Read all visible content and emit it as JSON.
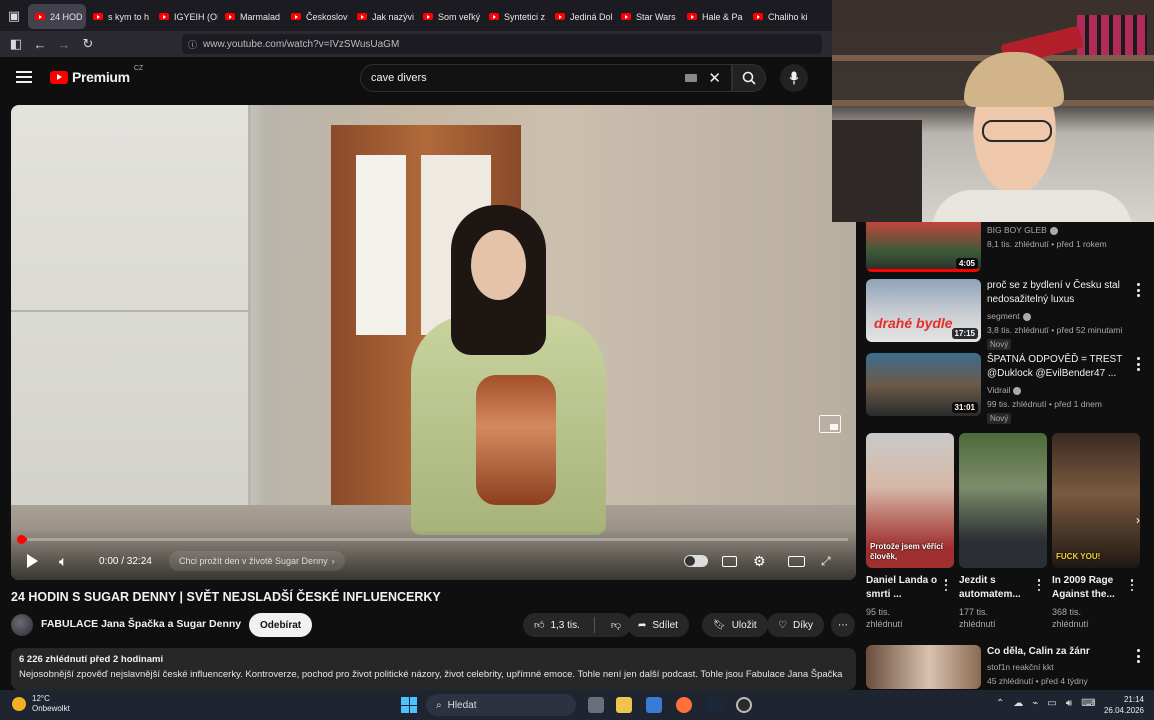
{
  "browser": {
    "tabs": [
      {
        "label": "24 HOD",
        "active": true
      },
      {
        "label": "s kym to h"
      },
      {
        "label": "IGYEIH (OI"
      },
      {
        "label": "Marmalad"
      },
      {
        "label": "Českoslov"
      },
      {
        "label": "Jak nazývi"
      },
      {
        "label": "Som veľký"
      },
      {
        "label": "Syntetici z"
      },
      {
        "label": "Jediná Dol"
      },
      {
        "label": "Star Wars"
      },
      {
        "label": "Hale & Pa"
      },
      {
        "label": "Chaliho ki"
      }
    ],
    "url": "www.youtube.com/watch?v=IVzSWusUaGM"
  },
  "header": {
    "logo_word": "Premium",
    "logo_country": "CZ",
    "search_value": "cave divers"
  },
  "player": {
    "time": "0:00 / 32:24",
    "chapter": "Chci prožít den v životě Sugar Denny",
    "progress_fraction": 0.01
  },
  "video": {
    "title": "24 HODIN S SUGAR DENNY | SVĚT NEJSLADŠÍ ČESKÉ INFLUENCERKY",
    "channel": "FABULACE Jana Špačka a Sugar Denny",
    "subscribe_label": "Odebírat",
    "likes": "1,3 tis.",
    "share_label": "Sdílet",
    "save_label": "Uložit",
    "thanks_label": "Díky",
    "views_date": "6 226 zhlédnutí  před 2 hodinami",
    "description": "Nejosobnější zpověď nejslavnější české influencerky. Kontroverze, pochod pro život politické názory, život celebrity, upřímné emoce. Tohle není jen další podcast. Tohle jsou Fabulace Jana Špačka"
  },
  "recommendations": [
    {
      "title": "",
      "channel": "BIG BOY GLEB",
      "meta": "8,1 tis. zhlédnutí • před 1 rokem",
      "duration": "4:05"
    },
    {
      "title": "proč se z bydlení v Česku stal nedosažitelný luxus",
      "channel": "segment",
      "meta": "3,8 tis. zhlédnutí • před 52 minutami",
      "duration": "17:15",
      "badge": "Nový",
      "thumb_text": "drahé bydle"
    },
    {
      "title": "ŠPATNÁ ODPOVĚĎ = TREST @Duklock @EvilBender47 ...",
      "channel": "Vidrail",
      "meta": "99 tis. zhlédnutí • před 1 dnem",
      "duration": "31:01",
      "badge": "Nový"
    }
  ],
  "shorts": [
    {
      "title": "Daniel Landa o smrti ...",
      "views": "95 tis. zhlédnutí",
      "caption": "Protože jsem věřící člověk,"
    },
    {
      "title": "Jezdit s automatem...",
      "views": "177 tis. zhlédnutí",
      "caption": ""
    },
    {
      "title": "In 2009 Rage Against the...",
      "views": "368 tis. zhlédnutí",
      "caption": "FUCK YOU!"
    }
  ],
  "rec_bottom": {
    "title": "Co děla, Calin za žánr",
    "channel": "stof1n reakční kkt",
    "meta": "45 zhlédnutí • před 4 týdny"
  },
  "taskbar": {
    "temp": "12°C",
    "weather": "Onbewolkt",
    "search_label": "Hledat",
    "time": "21:14",
    "date": "26.04.2026"
  }
}
